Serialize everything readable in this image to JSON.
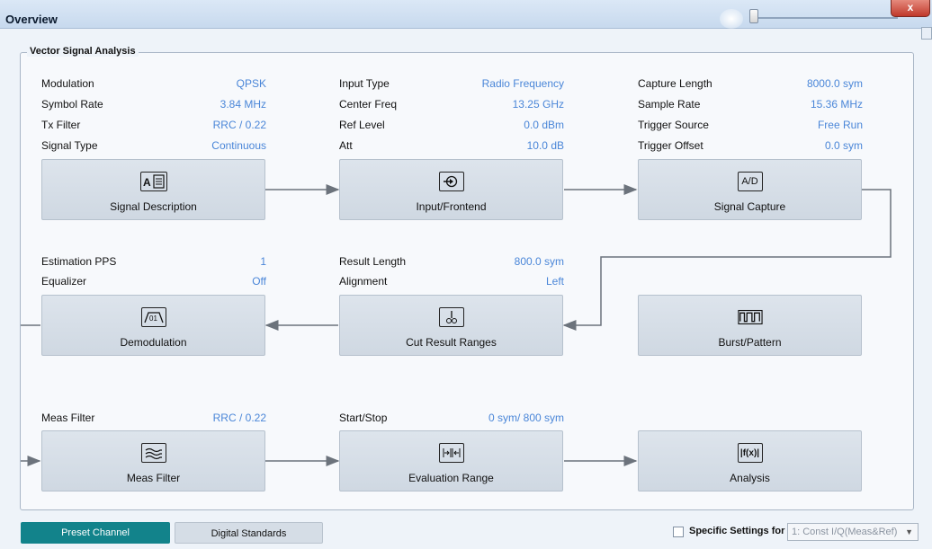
{
  "window": {
    "title": "Overview",
    "close_label": "x"
  },
  "group": {
    "title": "Vector Signal Analysis"
  },
  "params": {
    "modulation": {
      "label": "Modulation",
      "value": "QPSK"
    },
    "symbol_rate": {
      "label": "Symbol Rate",
      "value": "3.84 MHz"
    },
    "tx_filter": {
      "label": "Tx Filter",
      "value": "RRC / 0.22"
    },
    "signal_type": {
      "label": "Signal Type",
      "value": "Continuous"
    },
    "input_type": {
      "label": "Input Type",
      "value": "Radio Frequency"
    },
    "center_freq": {
      "label": "Center Freq",
      "value": "13.25 GHz"
    },
    "ref_level": {
      "label": "Ref Level",
      "value": "0.0 dBm"
    },
    "att": {
      "label": "Att",
      "value": "10.0 dB"
    },
    "capture_length": {
      "label": "Capture Length",
      "value": "8000.0 sym"
    },
    "sample_rate": {
      "label": "Sample Rate",
      "value": "15.36 MHz"
    },
    "trigger_source": {
      "label": "Trigger Source",
      "value": "Free Run"
    },
    "trigger_offset": {
      "label": "Trigger Offset",
      "value": "0.0 sym"
    },
    "estimation_pps": {
      "label": "Estimation PPS",
      "value": "1"
    },
    "equalizer": {
      "label": "Equalizer",
      "value": "Off"
    },
    "result_length": {
      "label": "Result Length",
      "value": "800.0 sym"
    },
    "alignment": {
      "label": "Alignment",
      "value": "Left"
    },
    "meas_filter": {
      "label": "Meas Filter",
      "value": "RRC / 0.22"
    },
    "start_stop": {
      "label": "Start/Stop",
      "value": "0 sym/ 800 sym"
    }
  },
  "blocks": {
    "signal_description": {
      "label": "Signal Description",
      "icon": "signal-description-icon"
    },
    "input_frontend": {
      "label": "Input/Frontend",
      "icon": "input-frontend-icon"
    },
    "signal_capture": {
      "label": "Signal Capture",
      "icon_text": "A/D"
    },
    "demodulation": {
      "label": "Demodulation",
      "icon_text": "01"
    },
    "cut_result_ranges": {
      "label": "Cut Result Ranges",
      "icon": "scissors-icon"
    },
    "burst_pattern": {
      "label": "Burst/Pattern",
      "icon": "burst-pattern-icon"
    },
    "meas_filter": {
      "label": "Meas Filter",
      "icon": "filter-wave-icon"
    },
    "evaluation_range": {
      "label": "Evaluation Range",
      "icon": "range-icon"
    },
    "analysis": {
      "label": "Analysis",
      "icon_text": "|f(x)|"
    }
  },
  "footer": {
    "preset_channel": "Preset Channel",
    "digital_standards": "Digital Standards",
    "specific_settings_label": "Specific Settings for",
    "specific_settings_value": "1: Const I/Q(Meas&Ref)",
    "specific_settings_checked": false
  },
  "colors": {
    "value_text": "#4a86d8",
    "preset_button": "#12838b",
    "block_bg": "#d5dde6"
  }
}
